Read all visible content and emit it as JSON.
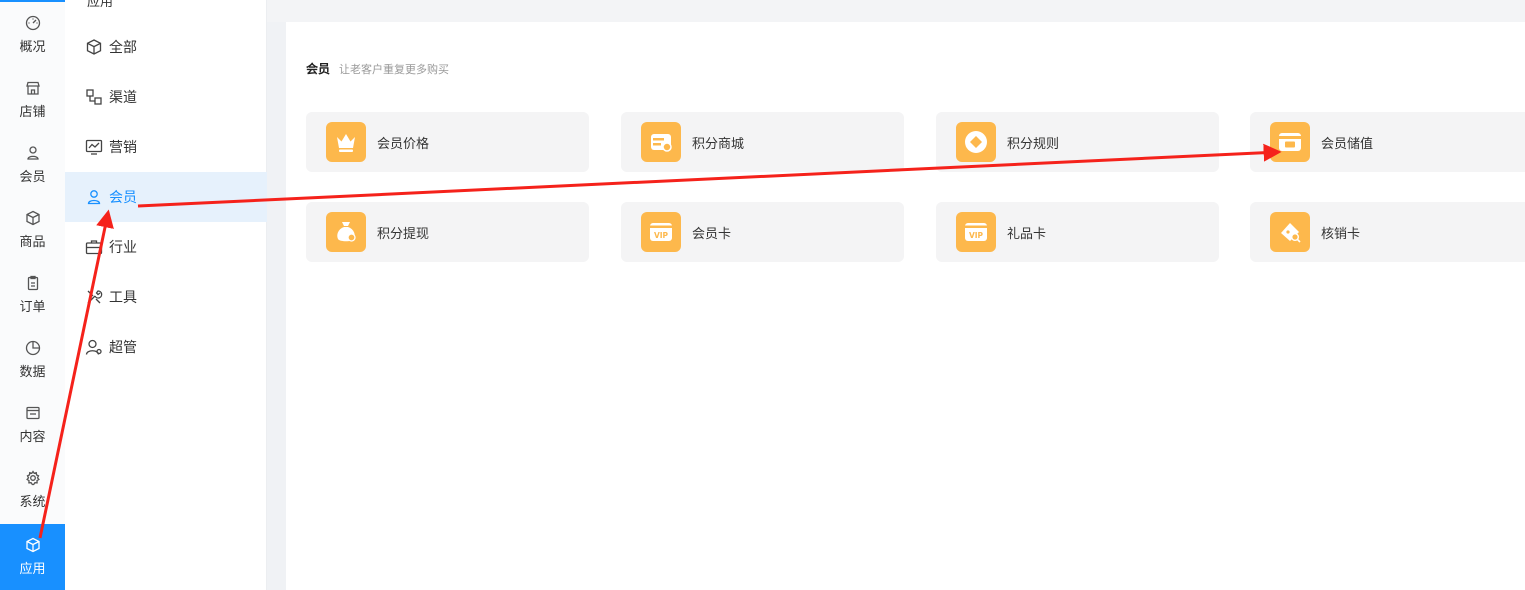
{
  "rail": {
    "items": [
      {
        "label": "概况",
        "icon": "dashboard-icon"
      },
      {
        "label": "店铺",
        "icon": "store-icon"
      },
      {
        "label": "会员",
        "icon": "user-icon"
      },
      {
        "label": "商品",
        "icon": "box-icon"
      },
      {
        "label": "订单",
        "icon": "clipboard-icon"
      },
      {
        "label": "数据",
        "icon": "pie-chart-icon"
      },
      {
        "label": "内容",
        "icon": "folder-icon"
      },
      {
        "label": "系统",
        "icon": "gear-icon"
      },
      {
        "label": "应用",
        "icon": "cube-icon"
      }
    ],
    "active": "应用"
  },
  "submenu": {
    "title": "应用",
    "items": [
      {
        "label": "全部",
        "icon": "cube-icon"
      },
      {
        "label": "渠道",
        "icon": "channels-icon"
      },
      {
        "label": "营销",
        "icon": "monitor-chart-icon"
      },
      {
        "label": "会员",
        "icon": "user-icon"
      },
      {
        "label": "行业",
        "icon": "briefcase-icon"
      },
      {
        "label": "工具",
        "icon": "tools-icon"
      },
      {
        "label": "超管",
        "icon": "admin-user-icon"
      }
    ],
    "active": "会员"
  },
  "section": {
    "title": "会员",
    "subtitle": "让老客户重复更多购买"
  },
  "cards": [
    {
      "label": "会员价格",
      "icon": "crown-icon"
    },
    {
      "label": "积分商城",
      "icon": "points-mall-icon"
    },
    {
      "label": "积分规则",
      "icon": "points-coin-icon"
    },
    {
      "label": "会员储值",
      "icon": "stored-value-icon"
    },
    {
      "label": "积分提现",
      "icon": "money-bag-icon"
    },
    {
      "label": "会员卡",
      "icon": "vip-card-icon"
    },
    {
      "label": "礼品卡",
      "icon": "vip-card-icon"
    },
    {
      "label": "核销卡",
      "icon": "ticket-verify-icon"
    }
  ],
  "colors": {
    "accent": "#1890ff",
    "card_icon_bg": "#fdb84c",
    "annotation_arrow": "#f5221b"
  }
}
